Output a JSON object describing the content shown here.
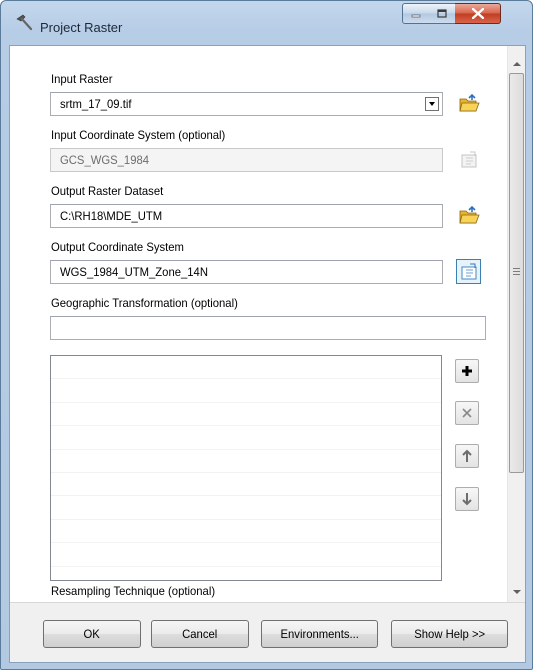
{
  "window": {
    "title": "Project Raster",
    "controls": {
      "minimize": "minimize",
      "maximize": "maximize",
      "close": "close"
    }
  },
  "form": {
    "input_raster": {
      "label": "Input Raster",
      "value": "srtm_17_09.tif"
    },
    "input_cs": {
      "label": "Input Coordinate System (optional)",
      "value": "GCS_WGS_1984"
    },
    "output_raster": {
      "label": "Output Raster Dataset",
      "value": "C:\\RH18\\MDE_UTM"
    },
    "output_cs": {
      "label": "Output Coordinate System",
      "value": "WGS_1984_UTM_Zone_14N"
    },
    "geo_transform": {
      "label": "Geographic Transformation (optional)",
      "value": ""
    },
    "transform_list": {
      "rows": [
        "",
        "",
        "",
        "",
        "",
        "",
        "",
        "",
        ""
      ]
    },
    "resampling": {
      "label": "Resampling Technique (optional)"
    }
  },
  "list_tools": {
    "add": "plus-icon",
    "remove": "x-icon",
    "up": "arrow-up-icon",
    "down": "arrow-down-icon"
  },
  "buttons": {
    "ok": "OK",
    "cancel": "Cancel",
    "environments": "Environments...",
    "help": "Show Help >>"
  },
  "colors": {
    "titlebar": "#b9cfe8",
    "close_button": "#c8452a",
    "folder_icon": "#f0c030",
    "selected_button": "#e5f3fb"
  }
}
